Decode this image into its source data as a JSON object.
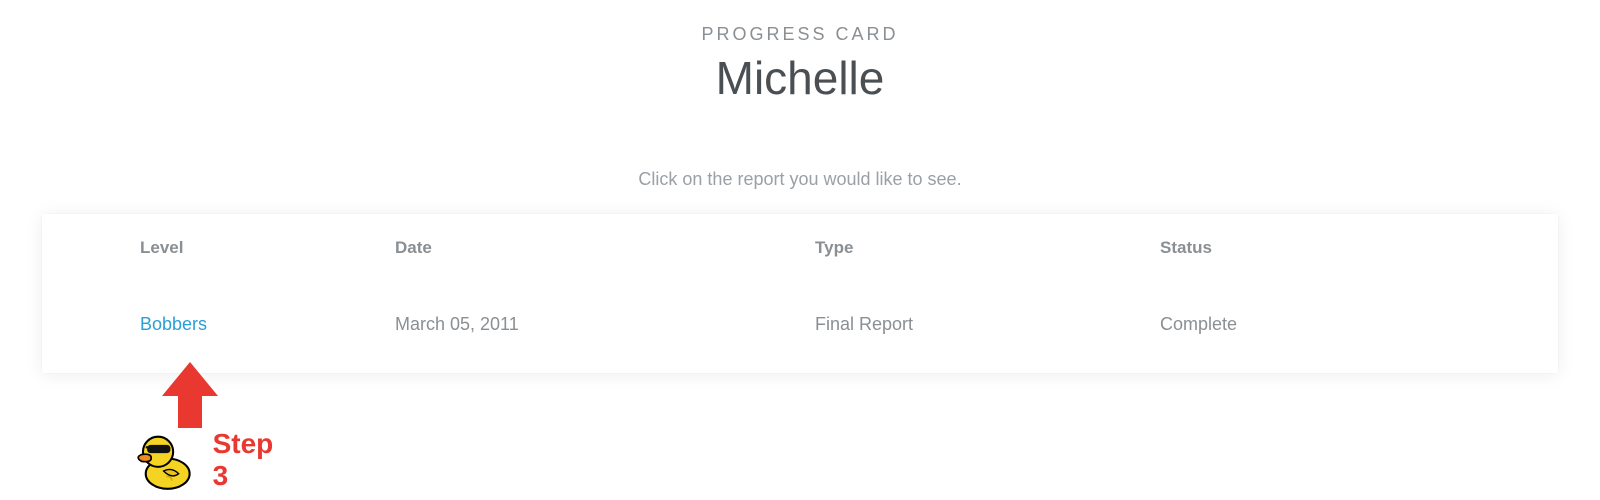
{
  "header": {
    "eyebrow": "PROGRESS CARD",
    "title": "Michelle"
  },
  "subtitle": "Click on the report you would like to see.",
  "table": {
    "headers": {
      "level": "Level",
      "date": "Date",
      "type": "Type",
      "status": "Status"
    },
    "rows": [
      {
        "level": "Bobbers",
        "date": "March 05, 2011",
        "type": "Final Report",
        "status": "Complete"
      }
    ]
  },
  "annotation": {
    "step_label": "Step 3",
    "accent_color": "#e8382f"
  }
}
